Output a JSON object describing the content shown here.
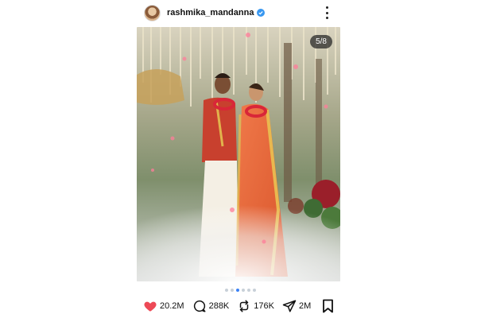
{
  "header": {
    "username": "rashmika_mandanna",
    "verified": true
  },
  "media": {
    "counter": "5/8",
    "total_slides": 8,
    "current_slide": 5,
    "dots": 6,
    "active_dot": 2
  },
  "actions": {
    "likes": "20.2M",
    "comments": "288K",
    "reposts": "176K",
    "shares": "2M",
    "liked": true
  },
  "colors": {
    "like": "#ed4956",
    "verified": "#3897f0",
    "dot_active": "#3b82f6"
  },
  "icons": [
    "heart-icon",
    "comment-icon",
    "repost-icon",
    "share-icon",
    "bookmark-icon",
    "more-icon",
    "verified-icon"
  ]
}
